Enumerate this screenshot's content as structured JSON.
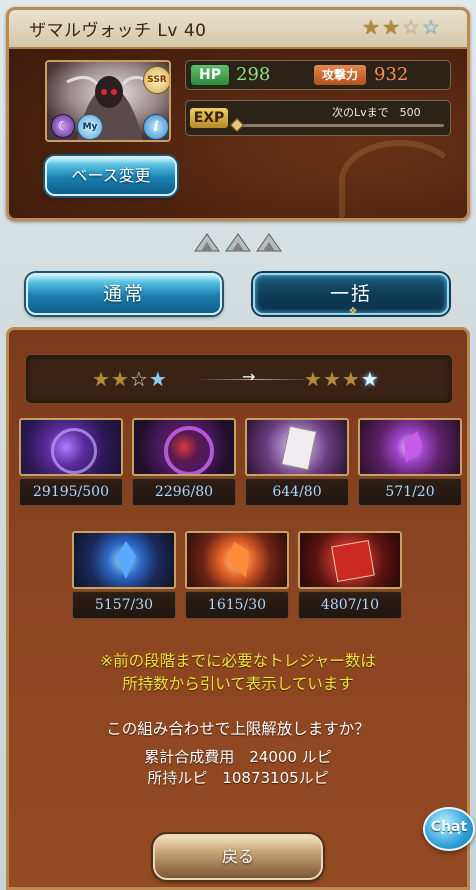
{
  "character": {
    "name": "ザマルヴォッチ Lv 40",
    "stars": [
      "gold",
      "gold",
      "empty",
      "blue"
    ],
    "badges": {
      "rarity": "SSR",
      "my": "My",
      "element": "dark-element-icon",
      "info": "i"
    },
    "hp_label": "HP",
    "hp_value": "298",
    "atk_label": "攻撃力",
    "atk_value": "932",
    "exp_label": "EXP",
    "exp_next_text": "次のLvまで　500",
    "base_change_label": "ベース変更"
  },
  "tabs": {
    "normal": "通常",
    "bulk": "一括",
    "selected": "bulk"
  },
  "uncap": {
    "from_stars": [
      "gold",
      "gold",
      "empty",
      "blue"
    ],
    "to_stars": [
      "gold",
      "gold",
      "gold",
      "blue"
    ],
    "arrow": "→"
  },
  "materials": [
    {
      "icon": "dark-orb-material-icon",
      "count": "29195/500"
    },
    {
      "icon": "dark-ring-material-icon",
      "count": "2296/80"
    },
    {
      "icon": "scroll-page-material-icon",
      "count": "644/80"
    },
    {
      "icon": "purple-crystal-material-icon",
      "count": "571/20"
    },
    {
      "icon": "blue-crystal-material-icon",
      "count": "5157/30"
    },
    {
      "icon": "orange-crystal-material-icon",
      "count": "1615/30"
    },
    {
      "icon": "red-scroll-material-icon",
      "count": "4807/10"
    }
  ],
  "notice": {
    "line1": "※前の段階までに必要なトレジャー数は",
    "line2": "所持数から引いて表示しています"
  },
  "confirm_question": "この組み合わせで上限解放しますか？",
  "cost": {
    "total_line": "累計合成費用　24000 ルピ",
    "owned_line": "所持ルピ　10873105ルピ"
  },
  "back_button": "戻る",
  "chat_button": "Chat",
  "colors": {
    "panel_brown": "#8a4420",
    "notice_yellow": "#f2e23c",
    "count_blue": "#a8d8ff",
    "accent_blue": "#1a7fae"
  }
}
